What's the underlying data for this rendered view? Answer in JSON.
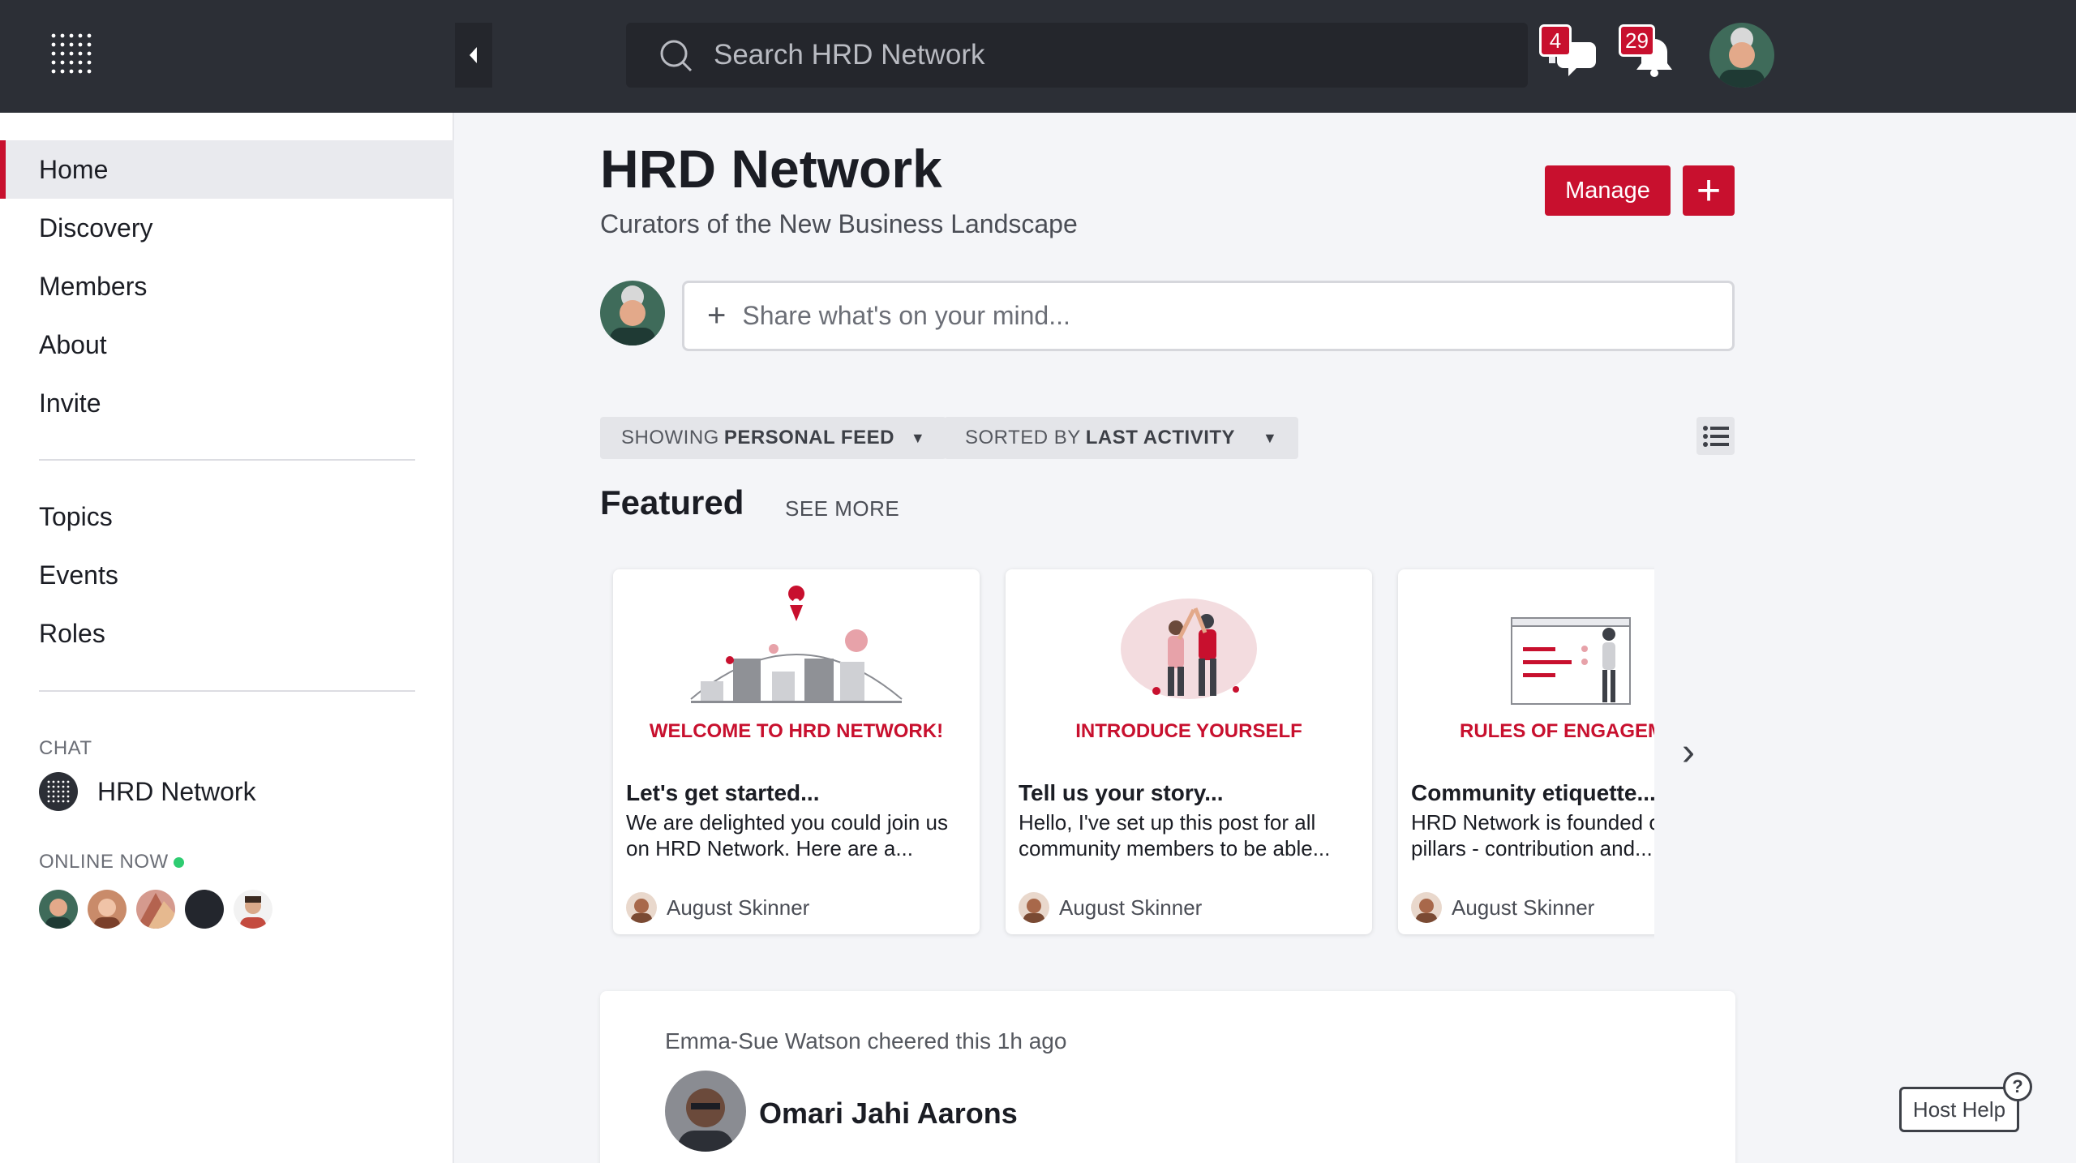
{
  "topbar": {
    "search_placeholder": "Search HRD Network",
    "messages_count": "4",
    "notifications_count": "29"
  },
  "sidebar": {
    "nav": [
      "Home",
      "Discovery",
      "Members",
      "About",
      "Invite"
    ],
    "secondary": [
      "Topics",
      "Events",
      "Roles"
    ],
    "chat_caption": "CHAT",
    "chat_room": "HRD Network",
    "online_caption": "ONLINE NOW"
  },
  "header": {
    "title": "HRD Network",
    "subtitle": "Curators of the New Business Landscape",
    "manage_label": "Manage",
    "add_label": "+"
  },
  "composer": {
    "placeholder": "Share what's on your mind..."
  },
  "filters": {
    "feed_prefix": "SHOWING",
    "feed_value": "PERSONAL FEED",
    "sort_prefix": "SORTED BY",
    "sort_value": "LAST ACTIVITY"
  },
  "featured": {
    "title": "Featured",
    "see_more": "SEE MORE",
    "cards": [
      {
        "banner": "WELCOME TO HRD NETWORK!",
        "title": "Let's get started...",
        "excerpt": "We are delighted you could join us on HRD Network.  Here are a...",
        "author": "August Skinner"
      },
      {
        "banner": "INTRODUCE YOURSELF",
        "title": "Tell us your story...",
        "excerpt": "Hello, I've set up this post for all community members to be able...",
        "author": "August Skinner"
      },
      {
        "banner": "RULES OF ENGAGEMENT",
        "title": "Community etiquette...",
        "excerpt": "HRD Network is founded on key pillars - contribution and...",
        "author": "August Skinner"
      }
    ]
  },
  "activity": {
    "cheer_text": "Emma-Sue Watson cheered this 1h ago",
    "author_name": "Omari Jahi Aarons"
  },
  "help": {
    "label": "Host Help",
    "icon_glyph": "?"
  },
  "colors": {
    "brand_red": "#c8102e",
    "topbar": "#2c2f36",
    "online_green": "#2ecc71"
  }
}
